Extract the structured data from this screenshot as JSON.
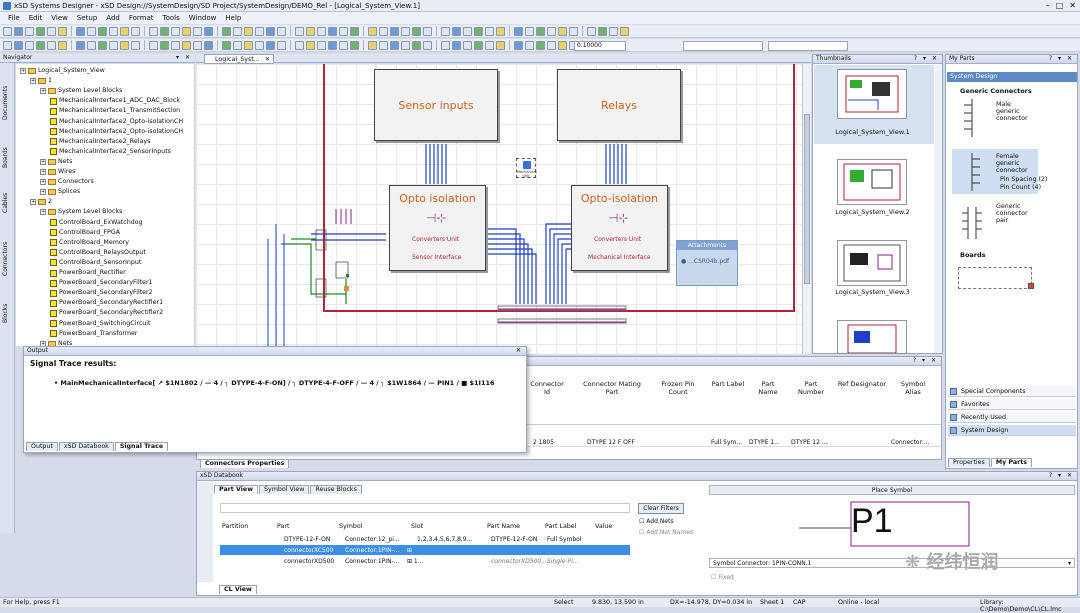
{
  "window": {
    "title": "xSD Systems Designer - xSD Design://SystemDesign/SD Project/SystemDesign/DEMO_Rel - [Logical_System_View.1]"
  },
  "menu": [
    "File",
    "Edit",
    "View",
    "Setup",
    "Add",
    "Format",
    "Tools",
    "Window",
    "Help"
  ],
  "toolbar": {
    "zoom_value": "0.10000"
  },
  "navigator": {
    "title": "Navigator",
    "tree": [
      {
        "label": "Logical_System_View",
        "level": 0,
        "kind": "root"
      },
      {
        "label": "1",
        "level": 1,
        "kind": "folder"
      },
      {
        "label": "System Level Blocks",
        "level": 2,
        "kind": "folder"
      },
      {
        "label": "MechanicalInterface1_ADC_DAC_Block",
        "level": 3,
        "kind": "block"
      },
      {
        "label": "MechanicalInterface1_TransmitSection",
        "level": 3,
        "kind": "block"
      },
      {
        "label": "MechanicalInterface2_Opto-isolationCH",
        "level": 3,
        "kind": "block"
      },
      {
        "label": "MechanicalInterface2_Opto-isolationCH",
        "level": 3,
        "kind": "block"
      },
      {
        "label": "MechanicalInterface2_Relays",
        "level": 3,
        "kind": "block"
      },
      {
        "label": "MechanicalInterface2_SensorInputs",
        "level": 3,
        "kind": "block"
      },
      {
        "label": "Nets",
        "level": 2,
        "kind": "folder"
      },
      {
        "label": "Wires",
        "level": 2,
        "kind": "folder"
      },
      {
        "label": "Connectors",
        "level": 2,
        "kind": "folder"
      },
      {
        "label": "Splices",
        "level": 2,
        "kind": "folder"
      },
      {
        "label": "2",
        "level": 1,
        "kind": "folder"
      },
      {
        "label": "System Level Blocks",
        "level": 2,
        "kind": "folder"
      },
      {
        "label": "ControlBoard_ExWatchdog",
        "level": 3,
        "kind": "block"
      },
      {
        "label": "ControlBoard_FPGA",
        "level": 3,
        "kind": "block"
      },
      {
        "label": "ControlBoard_Memory",
        "level": 3,
        "kind": "block"
      },
      {
        "label": "ControlBoard_RelaysOutput",
        "level": 3,
        "kind": "block"
      },
      {
        "label": "ControlBoard_SensorInput",
        "level": 3,
        "kind": "block"
      },
      {
        "label": "PowerBoard_Rectifier",
        "level": 3,
        "kind": "block"
      },
      {
        "label": "PowerBoard_SecondaryFilter1",
        "level": 3,
        "kind": "block"
      },
      {
        "label": "PowerBoard_SecondaryFilter2",
        "level": 3,
        "kind": "block"
      },
      {
        "label": "PowerBoard_SecondaryRectifier1",
        "level": 3,
        "kind": "block"
      },
      {
        "label": "PowerBoard_SecondaryRectifier2",
        "level": 3,
        "kind": "block"
      },
      {
        "label": "PowerBoard_SwitchingCircuit",
        "level": 3,
        "kind": "block"
      },
      {
        "label": "PowerBoard_Transformer",
        "level": 3,
        "kind": "block"
      },
      {
        "label": "Nets",
        "level": 2,
        "kind": "folder"
      }
    ]
  },
  "sidetabs": [
    "Documents",
    "Boards",
    "Cables",
    "Connectors",
    "Blocks"
  ],
  "editor": {
    "tab": "Logical_Syst...",
    "blocks": {
      "sensor": "Sensor inputs",
      "relays": "Relays",
      "opto1": "Opto isolation",
      "opto2": "Opto-isolation",
      "conv1": "Converters Unit",
      "sensor_if": "Sensor Interface",
      "conv2": "Converters Unit",
      "mech_if": "Mechanical Interface",
      "crossed": "Mechanical\nUnit"
    }
  },
  "attachments": {
    "title": "Attachments",
    "file": "...CSR04b.pdf"
  },
  "thumbnails": {
    "title": "Thumbnails",
    "items": [
      "Logical_System_View.1",
      "Logical_System_View.2",
      "Logical_System_View.3"
    ]
  },
  "myparts": {
    "title": "My Parts",
    "section": "System Design",
    "groups": [
      "Generic Connectors",
      "Boards"
    ],
    "parts": [
      "Male generic connector",
      "Female generic connector",
      "Pin Spacing (2)",
      "Pin Count (4)",
      "Generic connector pair"
    ],
    "accordion": [
      "Special Components",
      "Favorites",
      "Recently Used",
      "System Design"
    ],
    "tabs": [
      "Properties",
      "My Parts"
    ]
  },
  "output": {
    "title": "Output",
    "heading": "Signal Trace results:",
    "trace": "MainMechanicalInterface[ ↗ $1N1802 / — 4 / ┐ DTYPE-4-F-ON] / ┐ DTYPE-4-F-OFF / — 4 / ┐ $1W1864 / — PIN1 / ■ $1I116",
    "tabs": [
      "Output",
      "xSD Databook",
      "Signal Trace"
    ]
  },
  "connprops": {
    "tab": "Connectors Properties",
    "columns": [
      "Connector Id",
      "Connector Mating Part",
      "Frozen Pin Count",
      "Part Label",
      "Part Name",
      "Part Number",
      "Ref Designator",
      "Symbol Alias"
    ],
    "row": [
      "2 1805",
      "DTYPE 12 F OFF",
      "",
      "Full Sym...",
      "DTYPE 1...",
      "DTYPE 12 ...",
      "",
      "Connector:..."
    ]
  },
  "databook": {
    "title": "xSD Databook",
    "tabs": [
      "Part View",
      "Symbol View",
      "Reuse Blocks"
    ],
    "clear_filters": "Clear Filters",
    "add_nets": "Add Nets",
    "add_net_names": "Add Net Names",
    "columns": [
      "Partition",
      "Part",
      "Symbol",
      "Slot",
      "Part Name",
      "Part Label",
      "Value"
    ],
    "rows": [
      [
        "",
        "DTYPE-12-F-ON",
        "Connector:12_pi...",
        "1,2,3,4,5,6,7,8,9...",
        "DTYPE-12-F-ON",
        "Full Symbol",
        ""
      ],
      [
        "",
        "connectorXC500",
        "Connector:1PIN-...",
        "⊞",
        "",
        "",
        ""
      ],
      [
        "",
        "connectorXD500",
        "Connector:1PIN-...",
        "⊞ 1...",
        "connectorXD500...",
        "Single-Pi...",
        ""
      ]
    ],
    "place_symbol": "Place Symbol",
    "preview_text": "P1",
    "symbol_select": "Symbol Connector: 1PIN-CONN.1",
    "fixed": "Fixed",
    "tab": "CL View"
  },
  "status": {
    "help": "For Help, press F1",
    "mode": "Select",
    "coords": "9.830, 13.590 in",
    "delta": "DX=-14.978, DY=0.034 in",
    "sheet": "Sheet 1",
    "cap": "CAP",
    "online": "Online - local",
    "library": "Library: C:\\Demo\\Demo\\CL\\CL.lmc"
  },
  "watermark": "经纬恒润",
  "colors": {
    "accent": "#3a78c8",
    "block_text": "#c8641e",
    "net_blue": "#1f3fc7",
    "net_green": "#1c8a2a",
    "border_red": "#b2223a",
    "net_purple": "#8a1f8a"
  }
}
